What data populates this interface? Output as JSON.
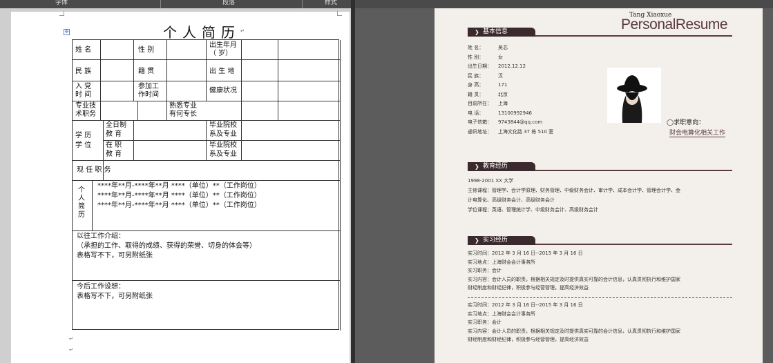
{
  "toolbar": {
    "font_group": "字体",
    "paragraph_group": "段落",
    "styles_group": "样式"
  },
  "left_doc": {
    "title": "个人简历",
    "rows": {
      "name": "姓  名",
      "gender": "性  别",
      "birth": "出生年月",
      "birth_unit": "（     岁）",
      "ethnicity": "民  族",
      "origin": "籍  贯",
      "birthplace": "出 生 地",
      "party_1": "入  党",
      "party_2": "时  间",
      "work_1": "参加工",
      "work_2": "作时间",
      "health": "健康状况",
      "title_1": "专业技",
      "title_2": "术职务",
      "skill_1": "熟悉专业",
      "skill_2": "有何专长",
      "edu_1": "学  历",
      "edu_2": "学  位",
      "fulltime_1": "全日制",
      "fulltime_2": "教  育",
      "school_a1": "毕业院校",
      "school_a2": "系及专业",
      "inservice_1": "在  职",
      "inservice_2": "教  育",
      "school_b1": "毕业院校",
      "school_b2": "系及专业",
      "position": "现  任  职  务",
      "resume_label": "个人简历",
      "history": [
        "****年**月-****年**月    ****（单位）**（工作岗位）",
        "****年**月-****年**月    ****（单位）**（工作岗位）",
        "****年**月-****年**月    ****（单位）**（工作岗位）"
      ],
      "past_title": "以往工作介绍：",
      "past_desc": "（承担的工作、取得的成绩、获得的荣誉、切身的体会等）",
      "past_note": "表格写不下，可另附纸张",
      "future_title": "今后工作设想：",
      "future_note": "表格写不下，可另附纸张"
    }
  },
  "right_doc": {
    "brand_small": "Tang Xiaoxue",
    "brand": "PersonalResume",
    "sections": {
      "basic": "基本信息",
      "edu": "教育经历",
      "intern": "实习经历"
    },
    "basic": [
      {
        "label": "姓      名：",
        "value": "吴芯"
      },
      {
        "label": "性      别：",
        "value": "女"
      },
      {
        "label": "出生日期：",
        "value": "2012.12.12"
      },
      {
        "label": "民      族：",
        "value": "汉"
      },
      {
        "label": "身      高：",
        "value": "171"
      },
      {
        "label": "籍      贯：",
        "value": "北京"
      },
      {
        "label": "目前所在：",
        "value": "上海"
      },
      {
        "label": "电      话：",
        "value": "13100992946"
      },
      {
        "label": "电子信箱：",
        "value": "9743844@qq.com"
      },
      {
        "label": "通讯地址：",
        "value": "上海文化路 37 栋 510 室"
      }
    ],
    "goal_label": "◯求职意向：",
    "goal_value": "财会电算化相关工作",
    "edu": [
      "1998-2001      XX 大学",
      "主修课程：管理学、会计学原理、财务管理、中级财务会计、审计学、成本会计学、管理会计学、金",
      "                    计电算化、高级财务会计、高级财务会计",
      "学位课程：英语、管理统计学、中级财务会计、高级财务会计"
    ],
    "intern_a": [
      "实习时间：2012 年 3 月 16 日--2015 年 3 月 16 日",
      "实习地点：上海财会会计事务所",
      "实习职务：会计",
      "实习内容：会计人员的职责，根据相关规定及时提供真实可靠的会计信息，认真贯彻执行和维护国家",
      "                    财经制度和财经纪律，积极参与经营管理，提高经济效益"
    ],
    "intern_b": [
      "实习时间：2012 年 3 月 16 日--2015 年 3 月 16 日",
      "实习地点：上海财会会计事务所",
      "实习职务：会计",
      "实习内容：会计人员的职责，根据相关规定及时提供真实可靠的会计信息，认真贯彻执行和维护国家",
      "                    财经制度和财经纪律，积极参与经营管理，提高经济效益"
    ]
  }
}
